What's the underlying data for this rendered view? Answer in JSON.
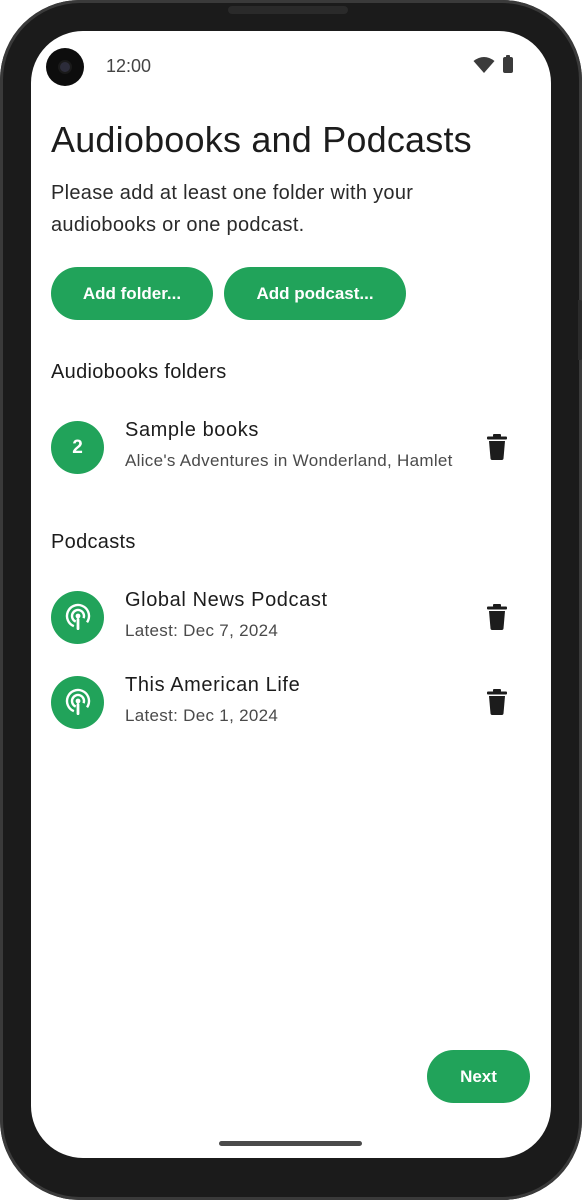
{
  "status_bar": {
    "time": "12:00",
    "icons": [
      "wifi-icon",
      "battery-icon"
    ]
  },
  "header": {
    "title": "Audiobooks and Podcasts",
    "subtitle": "Please add at least one folder with your audiobooks or one podcast."
  },
  "actions": {
    "add_folder_label": "Add folder...",
    "add_podcast_label": "Add podcast..."
  },
  "folders": {
    "heading": "Audiobooks folders",
    "items": [
      {
        "count": "2",
        "title": "Sample books",
        "subtitle": "Alice's Adventures in Wonderland, Hamlet"
      }
    ]
  },
  "podcasts": {
    "heading": "Podcasts",
    "items": [
      {
        "icon": "podcast-icon",
        "title": "Global News Podcast",
        "subtitle": "Latest: Dec 7, 2024"
      },
      {
        "icon": "podcast-icon",
        "title": "This American Life",
        "subtitle": "Latest: Dec 1, 2024"
      }
    ]
  },
  "footer": {
    "next_label": "Next"
  },
  "colors": {
    "accent": "#21a35a",
    "text": "#1c1c1c",
    "secondary_text": "#4a4a4a"
  }
}
